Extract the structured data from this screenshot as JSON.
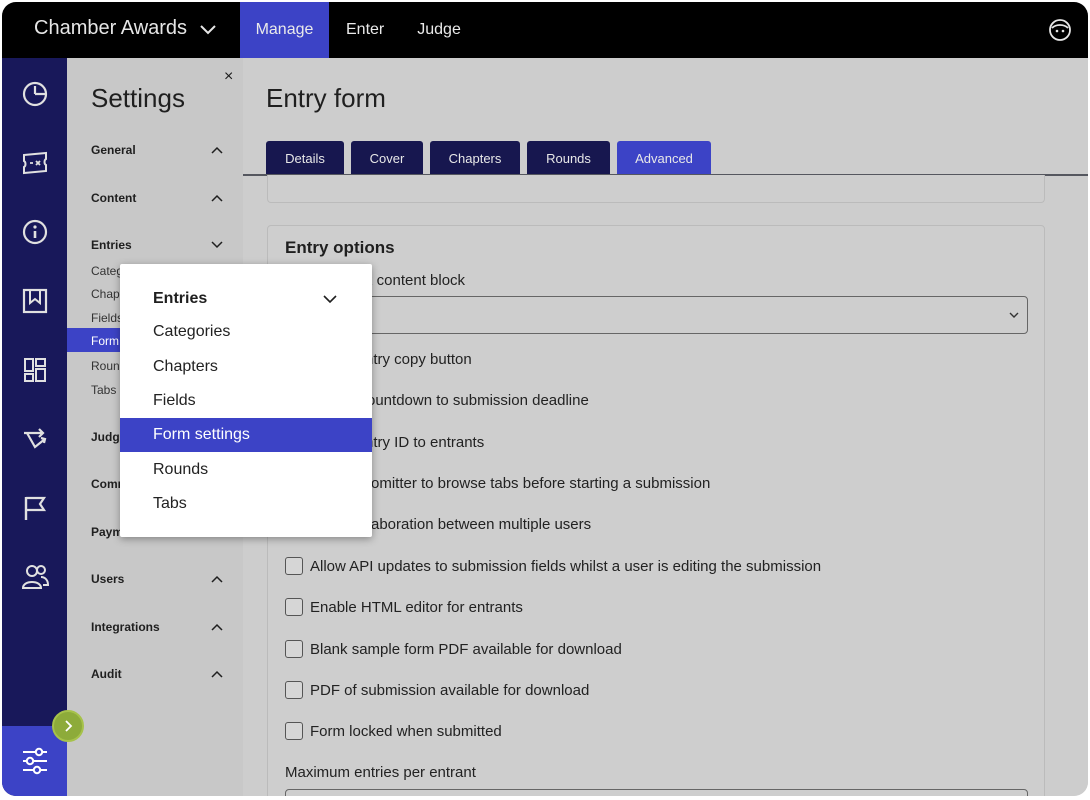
{
  "app": {
    "title": "Chamber Awards",
    "nav": [
      "Manage",
      "Enter",
      "Judge"
    ],
    "active_nav": "Manage"
  },
  "rail": {
    "icons": [
      "dashboard-icon",
      "ticket-icon",
      "info-icon",
      "bookmark-icon",
      "layout-icon",
      "share-icon",
      "flag-icon",
      "users-icon",
      "sliders-icon"
    ]
  },
  "settings": {
    "title": "Settings",
    "close": "×",
    "sections": {
      "general": "General",
      "content": "Content",
      "entries": "Entries",
      "judging": "Judgi",
      "communications": "Comm",
      "payments": "Paym",
      "users": "Users",
      "integrations": "Integrations",
      "audit": "Audit"
    },
    "entries_subitems": [
      "Categ",
      "Chapt",
      "Fields",
      "Form",
      "Roun",
      "Tabs"
    ]
  },
  "main": {
    "title": "Entry form",
    "tabs": [
      "Details",
      "Cover",
      "Chapters",
      "Rounds",
      "Advanced"
    ],
    "active_tab": "Advanced",
    "card_title": "Entry options",
    "content_block_label": "x content block",
    "options": [
      "ntry copy button",
      "ountdown to submission deadline",
      "ntry ID to entrants",
      "omitter to browse tabs before starting a submission",
      "aboration between multiple users",
      "Allow API updates to submission fields whilst a user is editing the submission",
      "Enable HTML editor for entrants",
      "Blank sample form PDF available for download",
      "PDF of submission available for download",
      "Form locked when submitted"
    ],
    "max_entries_label": "Maximum entries per entrant"
  },
  "popup": {
    "header": "Entries",
    "items": [
      "Categories",
      "Chapters",
      "Fields",
      "Form settings",
      "Rounds",
      "Tabs"
    ],
    "active_item": "Form settings"
  },
  "colors": {
    "accent": "#3c43c6",
    "rail": "#18185a",
    "tab": "#17174f",
    "expand": "#8dab3a"
  }
}
